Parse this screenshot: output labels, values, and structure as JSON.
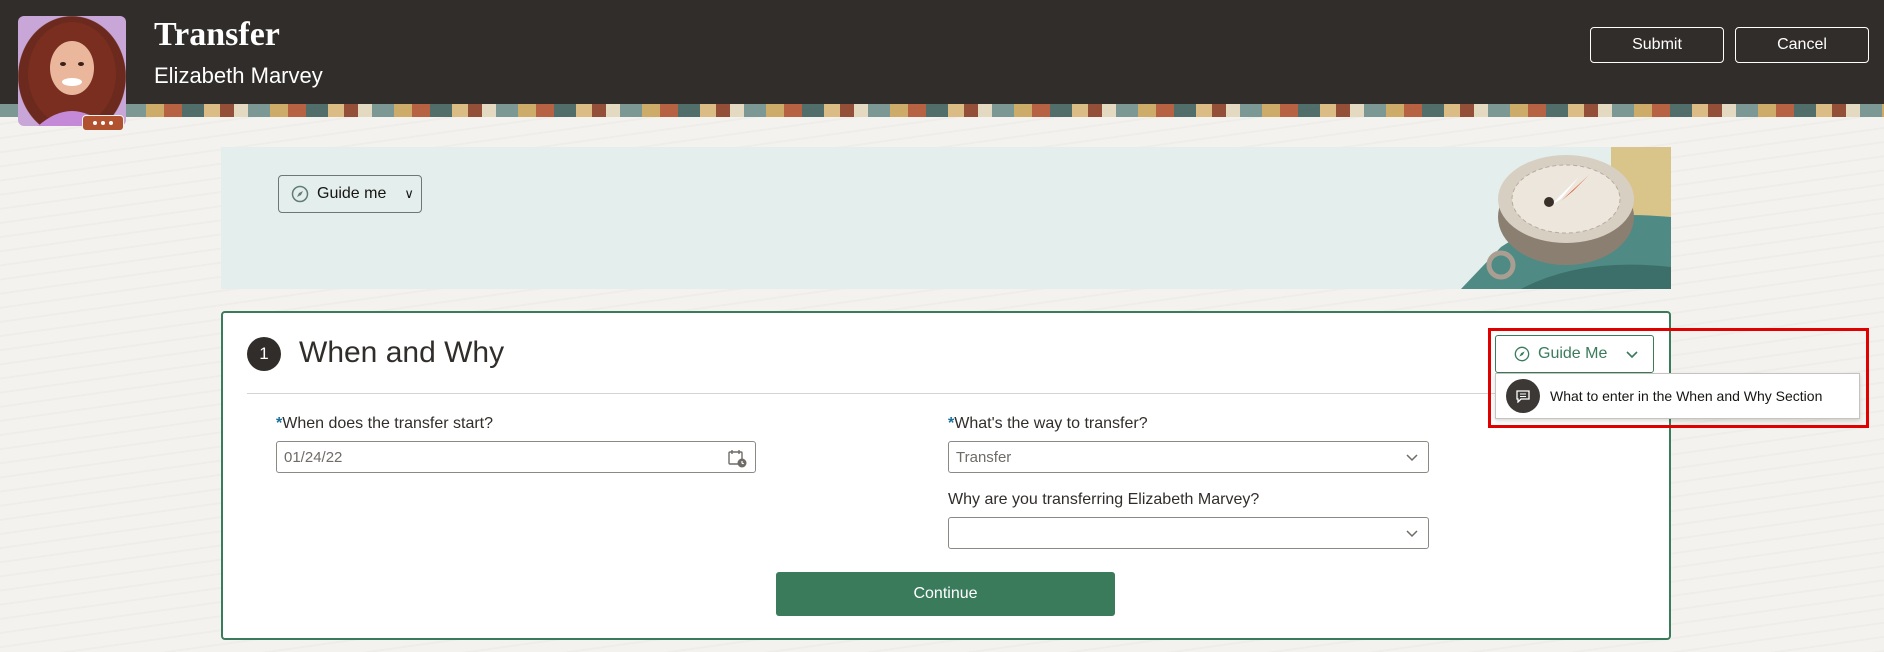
{
  "header": {
    "title": "Transfer",
    "subtitle": "Elizabeth Marvey",
    "submit_label": "Submit",
    "cancel_label": "Cancel"
  },
  "banner": {
    "guide_label": "Guide me"
  },
  "section": {
    "number": "1",
    "title": "When and Why",
    "guide_me_label": "Guide Me",
    "guide_menu_items": [
      {
        "label": "What to enter in the When and Why Section",
        "icon": "chat-icon"
      }
    ],
    "fields": {
      "start_date": {
        "label": "When does the transfer start?",
        "required_mark": "*",
        "value": "01/24/22"
      },
      "transfer_way": {
        "label": "What's the way to transfer?",
        "required_mark": "*",
        "value": "Transfer"
      },
      "transfer_reason": {
        "label": "Why are you transferring Elizabeth Marvey?",
        "value": ""
      }
    },
    "continue_label": "Continue"
  },
  "colors": {
    "header_bg": "#312d2a",
    "accent_green": "#3a7b5c",
    "banner_bg": "#e4eeec",
    "highlight_red": "#e00000"
  }
}
